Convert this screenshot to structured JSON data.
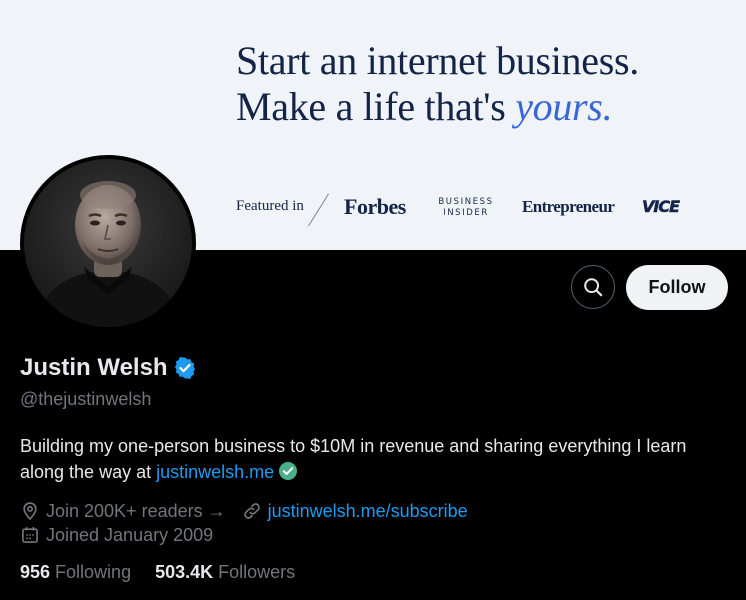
{
  "banner": {
    "headline_line1": "Start an internet business.",
    "headline_line2_prefix": "Make a life that's ",
    "headline_line2_accent": "yours.",
    "featured_label": "Featured in",
    "logos": [
      "Forbes",
      "BUSINESS",
      "INSIDER",
      "Entrepreneur",
      "VICE"
    ]
  },
  "profile": {
    "display_name": "Justin Welsh",
    "handle": "@thejustinwelsh",
    "bio_text": "Building my one-person business to $10M in revenue and sharing everything I learn along the way at ",
    "bio_link": "justinwelsh.me",
    "location": "Join 200K+ readers →",
    "website": "justinwelsh.me/subscribe",
    "joined": "Joined January 2009",
    "following_count": "956",
    "following_label": "Following",
    "followers_count": "503.4K",
    "followers_label": "Followers"
  },
  "actions": {
    "follow_label": "Follow"
  },
  "icons": {
    "search": "search-icon",
    "verified": "verified-badge-icon",
    "location": "location-pin-icon",
    "link": "link-icon",
    "calendar": "calendar-icon"
  },
  "colors": {
    "background": "#000000",
    "banner_bg": "#f0f4f9",
    "accent": "#1d9bf0",
    "muted": "#71767b",
    "headline": "#142447",
    "headline_accent": "#3a67d8",
    "follow_bg": "#eff3f4"
  }
}
